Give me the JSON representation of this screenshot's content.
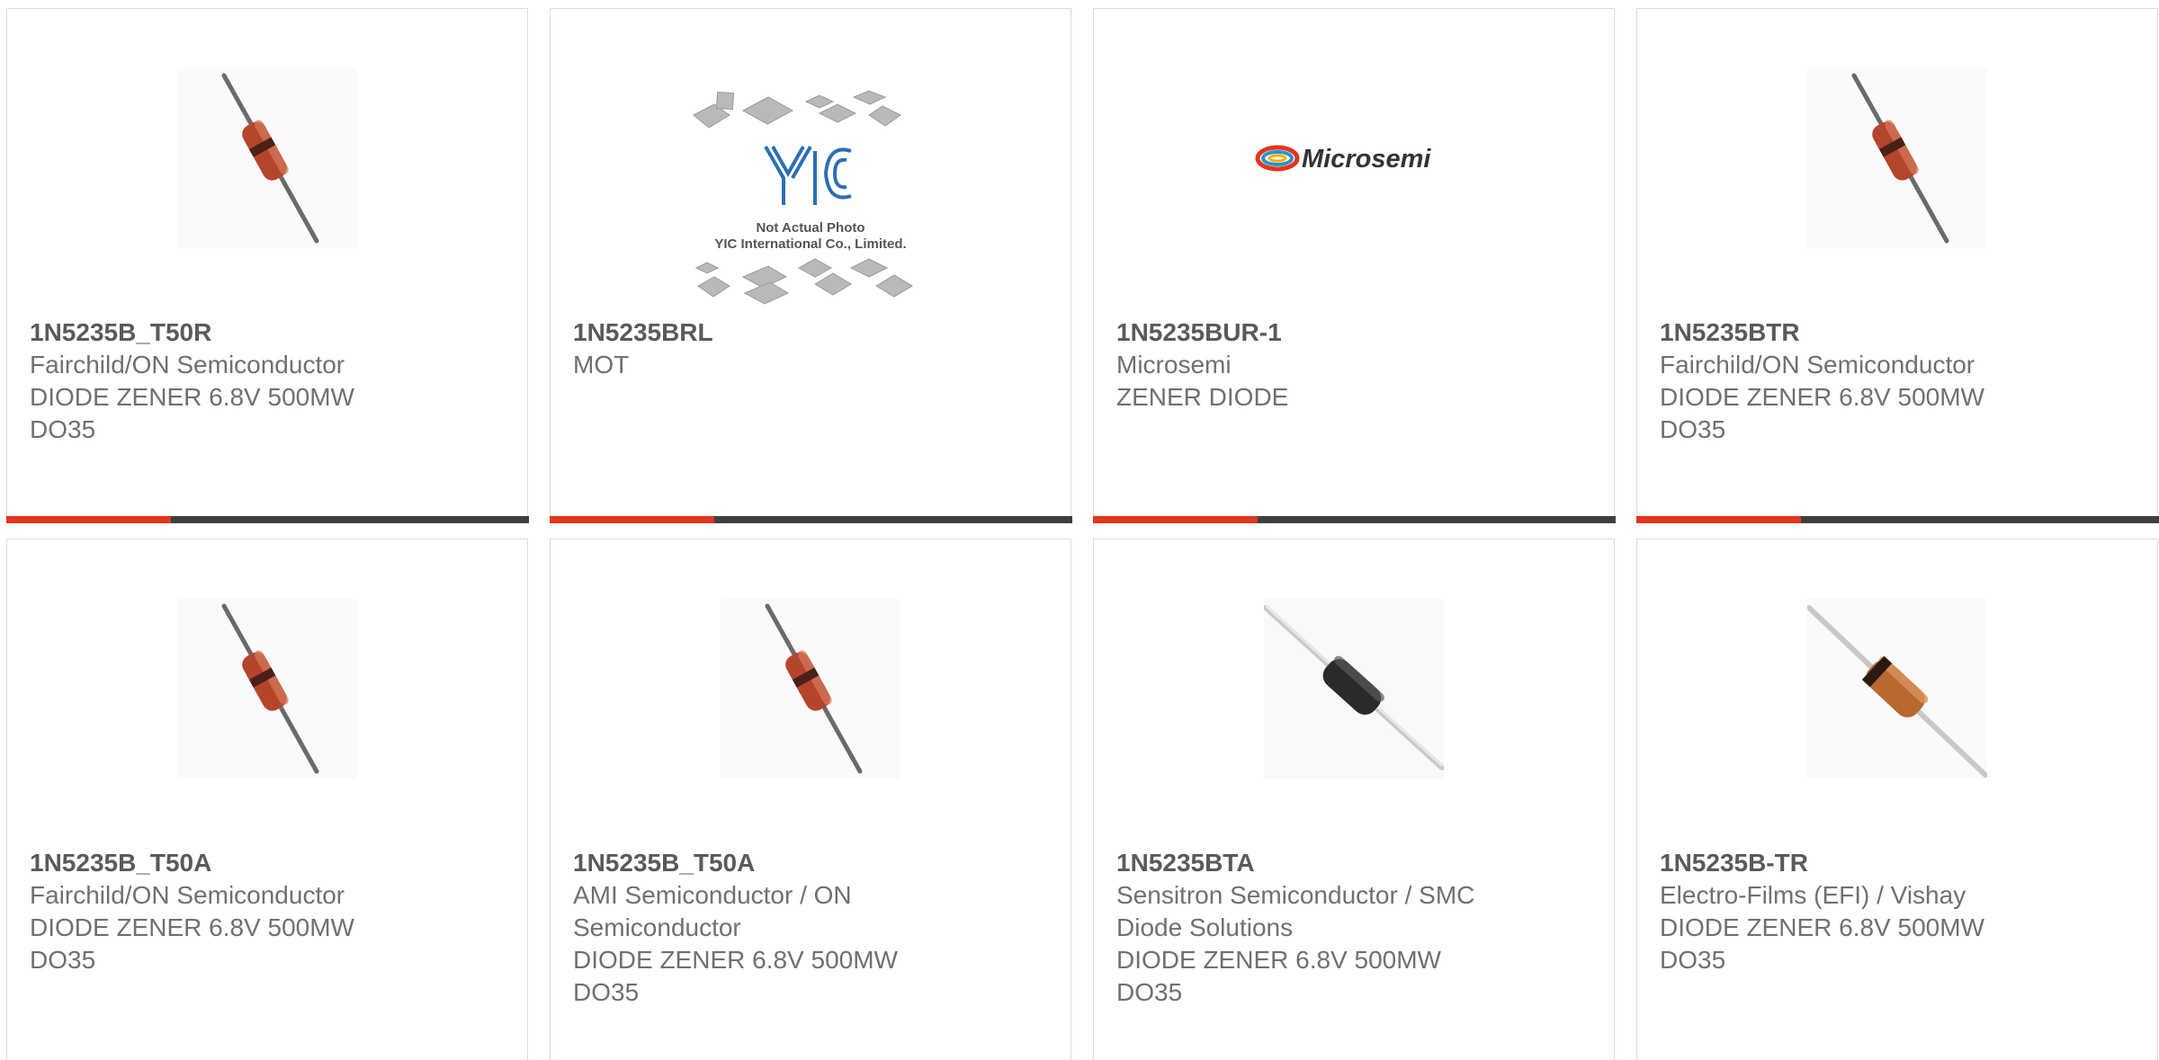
{
  "colors": {
    "accent": "#e2361b",
    "bar": "#3f3f3f",
    "border": "#dcdcdc",
    "text": "#707070"
  },
  "products": [
    {
      "part": "1N5235B_T50R",
      "lines": [
        "Fairchild/ON Semiconductor",
        "DIODE ZENER 6.8V 500MW",
        "DO35"
      ],
      "image": "diode-red-glass-icon"
    },
    {
      "part": "1N5235BRL",
      "lines": [
        "MOT"
      ],
      "image": "yic-placeholder",
      "placeholder": {
        "logo": "YIC",
        "caption1": "Not Actual Photo",
        "caption2": "YIC International Co., Limited."
      }
    },
    {
      "part": "1N5235BUR-1",
      "lines": [
        "Microsemi",
        "ZENER DIODE"
      ],
      "image": "microsemi-logo",
      "logo_text": "Microsemi"
    },
    {
      "part": "1N5235BTR",
      "lines": [
        "Fairchild/ON Semiconductor",
        "DIODE ZENER 6.8V 500MW",
        "DO35"
      ],
      "image": "diode-red-glass-icon"
    },
    {
      "part": "1N5235B_T50A",
      "lines": [
        "Fairchild/ON Semiconductor",
        "DIODE ZENER 6.8V 500MW",
        "DO35"
      ],
      "image": "diode-red-glass-icon"
    },
    {
      "part": "1N5235B_T50A",
      "lines": [
        "AMI Semiconductor / ON",
        "Semiconductor",
        "DIODE ZENER 6.8V 500MW",
        "DO35"
      ],
      "image": "diode-red-glass-icon"
    },
    {
      "part": "1N5235BTA",
      "lines": [
        "Sensitron Semiconductor / SMC",
        "Diode Solutions",
        "DIODE ZENER 6.8V 500MW",
        "DO35"
      ],
      "image": "diode-black-icon"
    },
    {
      "part": "1N5235B-TR",
      "lines": [
        "Electro-Films (EFI) / Vishay",
        "DIODE ZENER 6.8V 500MW",
        "DO35"
      ],
      "image": "diode-orange-icon"
    }
  ]
}
